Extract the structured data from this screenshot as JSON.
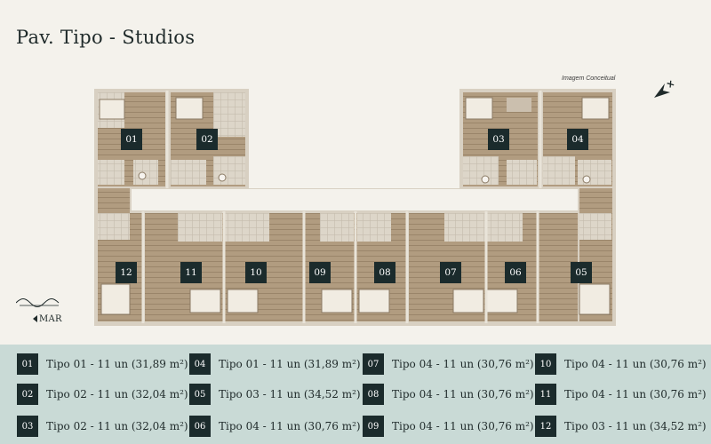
{
  "page": {
    "title": "Pav. Tipo - Studios",
    "caption": "Imagem Conceitual",
    "sea_label": "MAR"
  },
  "colors": {
    "background": "#f4f2ec",
    "legend_background": "#c9dad6",
    "label_fill": "#1b2b2c",
    "floor_wood": "#a7937a",
    "wall": "#e7e2d7"
  },
  "icons": {
    "north": "north-arrow-icon",
    "sea": "waves-icon",
    "sea_direction": "arrow-left-icon"
  },
  "units": [
    "01",
    "02",
    "03",
    "04",
    "05",
    "06",
    "07",
    "08",
    "09",
    "10",
    "11",
    "12"
  ],
  "legend": [
    {
      "num": "01",
      "text": "Tipo 01 - 11 un (31,89 m²)"
    },
    {
      "num": "02",
      "text": "Tipo 02 - 11 un (32,04 m²)"
    },
    {
      "num": "03",
      "text": "Tipo 02 - 11 un (32,04 m²)"
    },
    {
      "num": "04",
      "text": "Tipo 01 - 11 un (31,89 m²)"
    },
    {
      "num": "05",
      "text": "Tipo 03 - 11 un (34,52 m²)"
    },
    {
      "num": "06",
      "text": "Tipo 04 - 11 un (30,76 m²)"
    },
    {
      "num": "07",
      "text": "Tipo 04 - 11 un (30,76 m²)"
    },
    {
      "num": "08",
      "text": "Tipo 04 - 11 un (30,76 m²)"
    },
    {
      "num": "09",
      "text": "Tipo 04 - 11 un (30,76 m²)"
    },
    {
      "num": "10",
      "text": "Tipo 04 - 11 un (30,76 m²)"
    },
    {
      "num": "11",
      "text": "Tipo 04 - 11 un (30,76 m²)"
    },
    {
      "num": "12",
      "text": "Tipo 03 - 11 un (34,52 m²)"
    }
  ]
}
